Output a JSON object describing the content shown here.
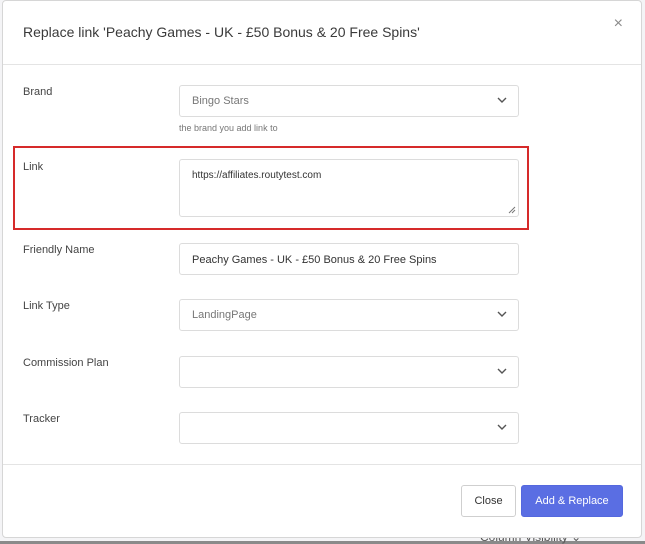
{
  "modal": {
    "title": "Replace link 'Peachy Games - UK - £50 Bonus & 20 Free Spins'",
    "close_icon": "×"
  },
  "form": {
    "brand": {
      "label": "Brand",
      "value": "Bingo Stars",
      "help": "the brand you add link to"
    },
    "link": {
      "label": "Link",
      "value": "https://affiliates.routytest.com"
    },
    "friendly_name": {
      "label": "Friendly Name",
      "value": "Peachy Games - UK - £50 Bonus & 20 Free Spins"
    },
    "link_type": {
      "label": "Link Type",
      "value": "LandingPage"
    },
    "commission_plan": {
      "label": "Commission Plan",
      "value": ""
    },
    "tracker": {
      "label": "Tracker",
      "value": ""
    }
  },
  "footer": {
    "close_label": "Close",
    "primary_label": "Add & Replace"
  },
  "background": {
    "bottom_text": "Column Visibility ⌄"
  },
  "colors": {
    "primary": "#5a6ee3",
    "highlight": "#d62a2a"
  }
}
